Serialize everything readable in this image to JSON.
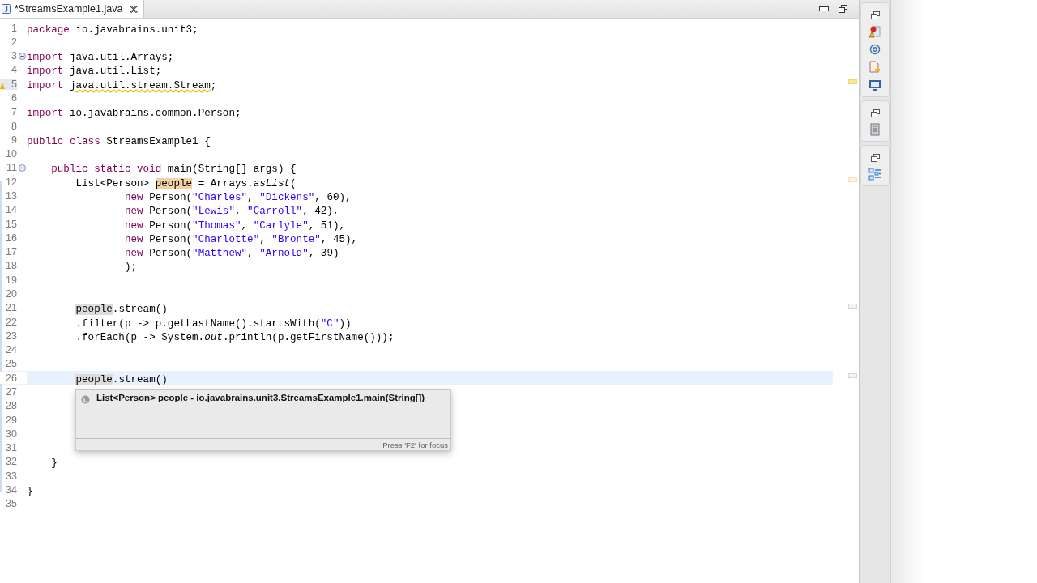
{
  "editor": {
    "tab": {
      "title": "*StreamsExample1.java",
      "selected": true
    },
    "lines": [
      {
        "number": "1",
        "tokens": [
          {
            "text": "package",
            "kind": "keyword"
          },
          {
            "text": " io.javabrains.unit3;",
            "kind": "plain"
          }
        ]
      },
      {
        "number": "2"
      },
      {
        "number": "3",
        "fold": true,
        "tokens": [
          {
            "text": "import",
            "kind": "keyword"
          },
          {
            "text": " java.util.Arrays;",
            "kind": "plain"
          }
        ]
      },
      {
        "number": "4",
        "tokens": [
          {
            "text": "import",
            "kind": "keyword"
          },
          {
            "text": " java.util.List;",
            "kind": "plain"
          }
        ]
      },
      {
        "number": "5",
        "warning": true,
        "tokens": [
          {
            "text": "import",
            "kind": "keyword"
          },
          {
            "text": " java.util.stream.Stream",
            "kind": "warning"
          },
          {
            "text": ";",
            "kind": "plain"
          }
        ]
      },
      {
        "number": "6"
      },
      {
        "number": "7",
        "tokens": [
          {
            "text": "import",
            "kind": "keyword"
          },
          {
            "text": " io.javabrains.common.Person;",
            "kind": "plain"
          }
        ]
      },
      {
        "number": "8"
      },
      {
        "number": "9",
        "tokens": [
          {
            "text": "public class",
            "kind": "keyword"
          },
          {
            "text": " StreamsExample1 {",
            "kind": "plain"
          }
        ]
      },
      {
        "number": "10"
      },
      {
        "number": "11",
        "fold": true,
        "tokens": [
          {
            "text": "    public static void",
            "kind": "keyword"
          },
          {
            "text": " main(String[] ",
            "kind": "plain"
          },
          {
            "text": "args",
            "kind": "plain"
          },
          {
            "text": ") {",
            "kind": "plain"
          }
        ]
      },
      {
        "number": "12",
        "tokens": [
          {
            "text": "        List<Person> ",
            "kind": "plain"
          },
          {
            "text": "people",
            "kind": "write-occurrence"
          },
          {
            "text": " = Arrays.",
            "kind": "plain"
          },
          {
            "text": "asList",
            "kind": "italic"
          },
          {
            "text": "(",
            "kind": "plain"
          }
        ]
      },
      {
        "number": "13",
        "tokens": [
          {
            "text": "                new",
            "kind": "keyword"
          },
          {
            "text": " Person(",
            "kind": "plain"
          },
          {
            "text": "\"Charles\"",
            "kind": "string"
          },
          {
            "text": ", ",
            "kind": "plain"
          },
          {
            "text": "\"Dickens\"",
            "kind": "string"
          },
          {
            "text": ", 60),",
            "kind": "plain"
          }
        ]
      },
      {
        "number": "14",
        "tokens": [
          {
            "text": "                new",
            "kind": "keyword"
          },
          {
            "text": " Person(",
            "kind": "plain"
          },
          {
            "text": "\"Lewis\"",
            "kind": "string"
          },
          {
            "text": ", ",
            "kind": "plain"
          },
          {
            "text": "\"Carroll\"",
            "kind": "string"
          },
          {
            "text": ", 42),",
            "kind": "plain"
          }
        ]
      },
      {
        "number": "15",
        "tokens": [
          {
            "text": "                new",
            "kind": "keyword"
          },
          {
            "text": " Person(",
            "kind": "plain"
          },
          {
            "text": "\"Thomas\"",
            "kind": "string"
          },
          {
            "text": ", ",
            "kind": "plain"
          },
          {
            "text": "\"Carlyle\"",
            "kind": "string"
          },
          {
            "text": ", 51),",
            "kind": "plain"
          }
        ]
      },
      {
        "number": "16",
        "tokens": [
          {
            "text": "                new",
            "kind": "keyword"
          },
          {
            "text": " Person(",
            "kind": "plain"
          },
          {
            "text": "\"Charlotte\"",
            "kind": "string"
          },
          {
            "text": ", ",
            "kind": "plain"
          },
          {
            "text": "\"Bronte\"",
            "kind": "string"
          },
          {
            "text": ", 45),",
            "kind": "plain"
          }
        ]
      },
      {
        "number": "17",
        "tokens": [
          {
            "text": "                new",
            "kind": "keyword"
          },
          {
            "text": " Person(",
            "kind": "plain"
          },
          {
            "text": "\"Matthew\"",
            "kind": "string"
          },
          {
            "text": ", ",
            "kind": "plain"
          },
          {
            "text": "\"Arnold\"",
            "kind": "string"
          },
          {
            "text": ", 39)",
            "kind": "plain"
          }
        ]
      },
      {
        "number": "18",
        "tokens": [
          {
            "text": "                );",
            "kind": "plain"
          }
        ]
      },
      {
        "number": "19"
      },
      {
        "number": "20"
      },
      {
        "number": "21",
        "tokens": [
          {
            "text": "        people",
            "kind": "read-occurrence"
          },
          {
            "text": ".stream()",
            "kind": "plain"
          }
        ]
      },
      {
        "number": "22",
        "tokens": [
          {
            "text": "        .filter(p -> p.getLastName().startsWith(",
            "kind": "plain"
          },
          {
            "text": "\"C\"",
            "kind": "string"
          },
          {
            "text": "))",
            "kind": "plain"
          }
        ]
      },
      {
        "number": "23",
        "tokens": [
          {
            "text": "        .forEach(p -> System.",
            "kind": "plain"
          },
          {
            "text": "out",
            "kind": "italic"
          },
          {
            "text": ".println(p.getFirstName()));",
            "kind": "plain"
          }
        ]
      },
      {
        "number": "24"
      },
      {
        "number": "25"
      },
      {
        "number": "26",
        "current": true,
        "tokens": [
          {
            "text": "        people",
            "kind": "read-occurrence"
          },
          {
            "text": ".stream()",
            "kind": "plain"
          }
        ]
      },
      {
        "number": "27"
      },
      {
        "number": "28"
      },
      {
        "number": "29"
      },
      {
        "number": "30"
      },
      {
        "number": "31"
      },
      {
        "number": "32",
        "tokens": [
          {
            "text": "    }",
            "kind": "plain"
          }
        ]
      },
      {
        "number": "33"
      },
      {
        "number": "34",
        "tokens": [
          {
            "text": "}",
            "kind": "plain"
          }
        ]
      },
      {
        "number": "35"
      }
    ],
    "hover": {
      "signature": "List<Person> people - io.javabrains.unit3.StreamsExample1.main(String[])",
      "footer": "Press 'F2' for focus"
    }
  }
}
